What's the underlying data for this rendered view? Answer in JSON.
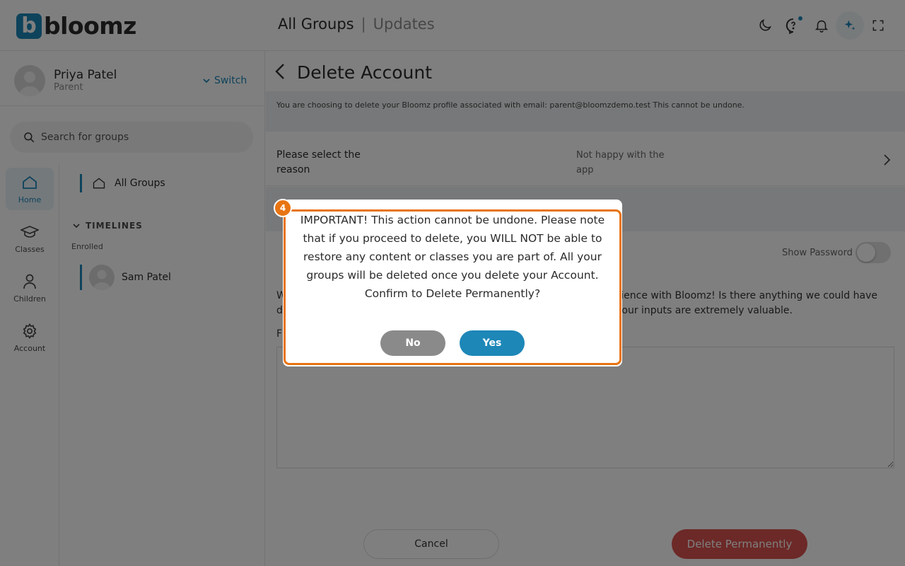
{
  "header": {
    "logo_mark": "b",
    "logo_text": "bloomz",
    "nav_active": "All Groups",
    "nav_separator": "|",
    "nav_inactive": "Updates",
    "icons": [
      "moon-icon",
      "help-chat-icon",
      "bell-icon",
      "sparkle-icon",
      "fullscreen-icon"
    ]
  },
  "profile": {
    "name": "Priya Patel",
    "role": "Parent",
    "switch_label": "Switch"
  },
  "search": {
    "placeholder": "Search for groups"
  },
  "rail": {
    "items": [
      {
        "label": "Home",
        "icon": "home-icon",
        "active": true
      },
      {
        "label": "Classes",
        "icon": "graduation-cap-icon",
        "active": false
      },
      {
        "label": "Children",
        "icon": "person-icon",
        "active": false
      },
      {
        "label": "Account",
        "icon": "gear-icon",
        "active": false
      }
    ]
  },
  "groups": {
    "all_groups": "All Groups",
    "timelines_heading": "TIMELINES",
    "enrolled_label": "Enrolled",
    "children": [
      {
        "name": "Sam Patel"
      }
    ]
  },
  "main": {
    "title": "Delete Account",
    "notice": "You are choosing to delete your Bloomz profile associated with email: parent@bloomzdemo.test This cannot be undone.",
    "reason_label": "Please select the reason",
    "reason_value": "Not happy with the app",
    "show_password": "Show Password",
    "feedback_left": "W",
    "feedback_right": "perience with Bloomz! Is there anything we could have",
    "feedback_left2": "d",
    "feedback_right2": "o your inputs are extremely valuable.",
    "feedback_label": "F",
    "cancel_label": "Cancel",
    "delete_label": "Delete Permanently"
  },
  "modal": {
    "step": "4",
    "message": "IMPORTANT! This action cannot be undone. Please note that if you proceed to delete, you WILL NOT be able to restore any content or classes you are part of. All your groups will be deleted once you delete your Account. Confirm to Delete Permanently?",
    "no_label": "No",
    "yes_label": "Yes"
  },
  "colors": {
    "accent": "#1d87b8",
    "highlight": "#e87412",
    "danger": "#d9534f"
  }
}
